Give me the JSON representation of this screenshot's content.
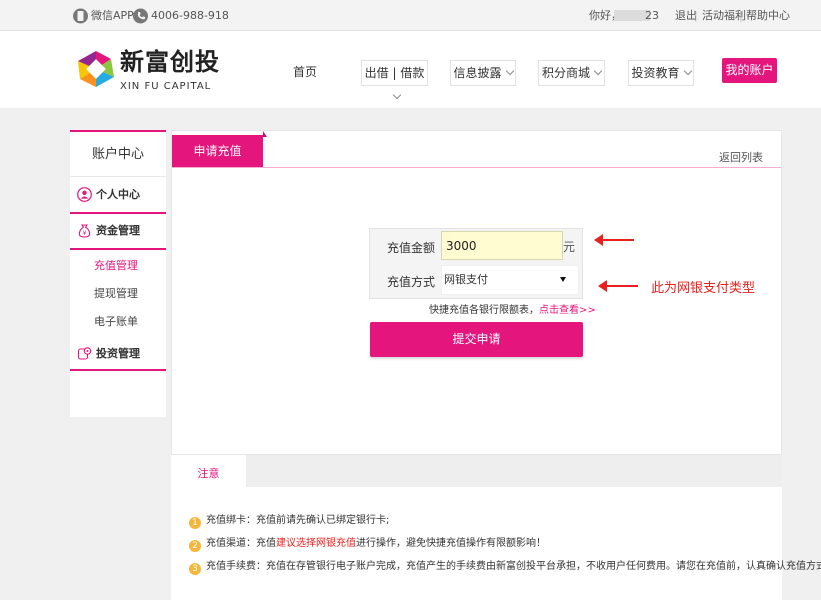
{
  "topbar": {
    "wechat_app": "微信APP",
    "phone": "4006-988-918",
    "greeting": "你好，",
    "username_suffix": "23",
    "logout": "退出",
    "activity": "活动福利",
    "help": "帮助中心"
  },
  "logo": {
    "name_cn": "新富创投",
    "name_en": "XIN FU CAPITAL"
  },
  "nav": {
    "home": "首页",
    "lend": "出借 | 借款",
    "disclosure": "信息披露",
    "points": "积分商城",
    "education": "投资教育",
    "my_account": "我的账户"
  },
  "sidebar": {
    "title": "账户中心",
    "personal": "个人中心",
    "funds": "资金管理",
    "recharge": "充值管理",
    "withdraw": "提现管理",
    "statement": "电子账单",
    "invest": "投资管理"
  },
  "main": {
    "tab": "申请充值",
    "back": "返回列表",
    "amount_label": "充值金额",
    "amount_value": "3000",
    "unit": "元",
    "method_label": "充值方式",
    "method_value": "网银支付",
    "limits_text": "快捷充值各银行限额表，",
    "limits_link": "点击查看>>",
    "submit": "提交申请"
  },
  "annotation": {
    "text": "此为网银支付类型"
  },
  "notice": {
    "tab": "注意",
    "items": [
      {
        "num": "1",
        "pre": "充值绑卡：充值前请先确认已绑定银行卡;",
        "hl": "",
        "post": ""
      },
      {
        "num": "2",
        "pre": "充值渠道：充值",
        "hl": "建议选择网银充值",
        "post": "进行操作，避免快捷充值操作有限额影响！"
      },
      {
        "num": "3",
        "pre": "充值手续费：充值在存管银行电子账户完成，充值产生的手续费由新富创投平台承担，不收用户任何费用。请您在充值前，认真确认充值方式。",
        "hl": "",
        "post": ""
      }
    ]
  },
  "colors": {
    "brand": "#e4157c",
    "annotation": "#e8211e",
    "notice_badge": "#f5b63a"
  }
}
